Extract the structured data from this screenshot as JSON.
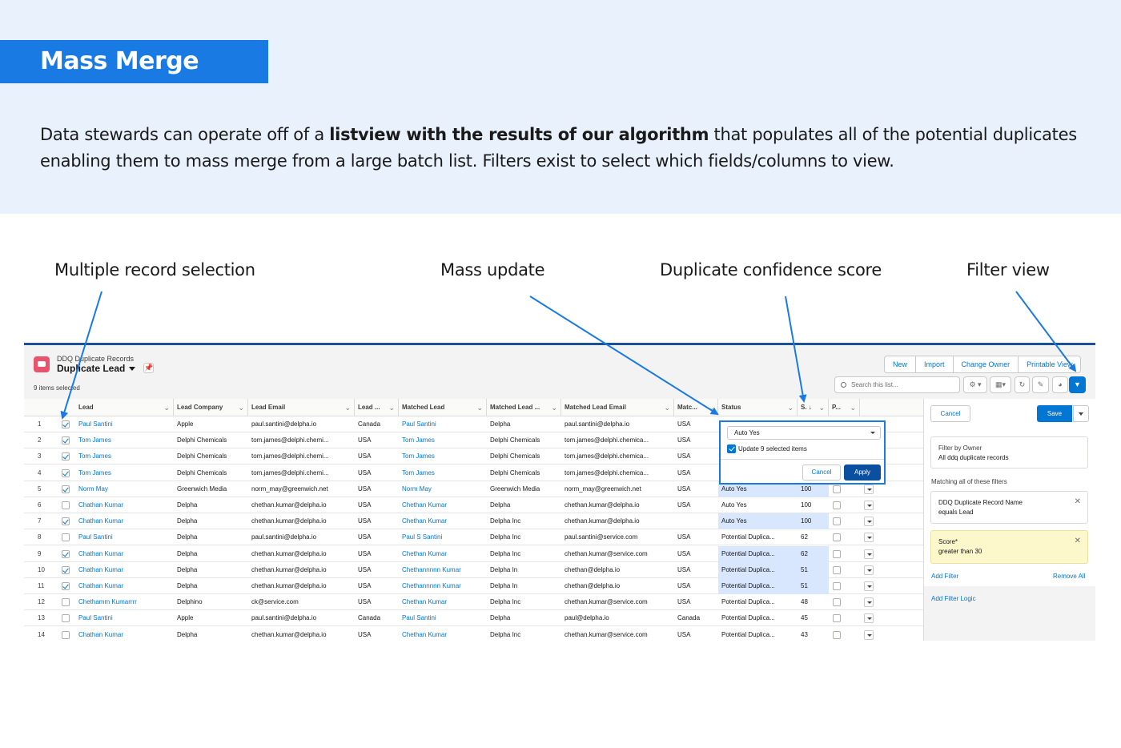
{
  "header": {
    "title": "Mass Merge",
    "desc_before": "Data stewards can operate off of a ",
    "desc_bold": "listview with the results of our algorithm",
    "desc_after": " that populates all of the potential duplicates enabling them to mass merge from a large batch list. Filters exist to select which fields/columns to view."
  },
  "callouts": {
    "selection": "Multiple record selection",
    "mass_update": "Mass update",
    "confidence": "Duplicate confidence score",
    "filter": "Filter view"
  },
  "colors": {
    "accent": "#1a7ae3",
    "link": "#0176d3",
    "highlight": "#d8e6fe",
    "warning": "#fcf8cc"
  },
  "app": {
    "object_subtitle": "DDQ Duplicate Records",
    "list_name": "Duplicate Lead",
    "selected_count": "9 items selected",
    "buttons": {
      "new": "New",
      "import": "Import",
      "change_owner": "Change Owner",
      "printable_view": "Printable View"
    },
    "search_placeholder": "Search this list...",
    "icons": [
      "settings-gear-icon",
      "table-view-icon",
      "refresh-icon",
      "edit-pencil-icon",
      "chart-icon",
      "filter-icon"
    ]
  },
  "columns": [
    "Lead",
    "Lead Company",
    "Lead Email",
    "Lead ...",
    "Matched Lead",
    "Matched Lead ...",
    "Matched Lead Email",
    "Matc...",
    "Status",
    "S. ↓",
    "P..."
  ],
  "rows": [
    {
      "n": "1",
      "sel": true,
      "lead": "Paul Santini",
      "company": "Apple",
      "email": "paul.santini@delpha.io",
      "country": "Canada",
      "m_lead": "Paul Santini",
      "m_company": "Delpha",
      "m_email": "paul.santini@delpha.io",
      "m_country": "USA",
      "status": "",
      "score": "",
      "hl": false
    },
    {
      "n": "2",
      "sel": true,
      "lead": "Tom James",
      "company": "Delphi Chemicals",
      "email": "tom.james@delphi.chemi...",
      "country": "USA",
      "m_lead": "Tom James",
      "m_company": "Delphi Chemicals",
      "m_email": "tom.james@delphi.chemica...",
      "m_country": "USA",
      "status": "",
      "score": "",
      "hl": false
    },
    {
      "n": "3",
      "sel": true,
      "lead": "Tom James",
      "company": "Delphi Chemicals",
      "email": "tom.james@delphi.chemi...",
      "country": "USA",
      "m_lead": "Tom James",
      "m_company": "Delphi Chemicals",
      "m_email": "tom.james@delphi.chemica...",
      "m_country": "USA",
      "status": "",
      "score": "",
      "hl": false
    },
    {
      "n": "4",
      "sel": true,
      "lead": "Tom James",
      "company": "Delphi Chemicals",
      "email": "tom.james@delphi.chemi...",
      "country": "USA",
      "m_lead": "Tom James",
      "m_company": "Delphi Chemicals",
      "m_email": "tom.james@delphi.chemica...",
      "m_country": "USA",
      "status": "",
      "score": "",
      "hl": false
    },
    {
      "n": "5",
      "sel": true,
      "lead": "Norm May",
      "company": "Greenwich Media",
      "email": "norm_may@greenwich.net",
      "country": "USA",
      "m_lead": "Norm May",
      "m_company": "Greenwich Media",
      "m_email": "norm_may@greenwich.net",
      "m_country": "USA",
      "status": "Auto Yes",
      "score": "100",
      "hl": true
    },
    {
      "n": "6",
      "sel": false,
      "lead": "Chathan Kumar",
      "company": "Delpha",
      "email": "chethan.kumar@delpha.io",
      "country": "USA",
      "m_lead": "Chethan Kumar",
      "m_company": "Delpha",
      "m_email": "chethan.kumar@delpha.io",
      "m_country": "USA",
      "status": "Auto Yes",
      "score": "100",
      "hl": false
    },
    {
      "n": "7",
      "sel": true,
      "lead": "Chathan Kumar",
      "company": "Delpha",
      "email": "chethan.kumar@delpha.io",
      "country": "USA",
      "m_lead": "Chethan Kumar",
      "m_company": "Delpha Inc",
      "m_email": "chethan.kumar@delpha.io",
      "m_country": "",
      "status": "Auto Yes",
      "score": "100",
      "hl": true
    },
    {
      "n": "8",
      "sel": false,
      "lead": "Paul Santini",
      "company": "Delpha",
      "email": "paul.santini@delpha.io",
      "country": "USA",
      "m_lead": "Paul S Santini",
      "m_company": "Delpha Inc",
      "m_email": "paul.santini@service.com",
      "m_country": "USA",
      "status": "Potential Duplica...",
      "score": "62",
      "hl": false
    },
    {
      "n": "9",
      "sel": true,
      "lead": "Chathan Kumar",
      "company": "Delpha",
      "email": "chethan.kumar@delpha.io",
      "country": "USA",
      "m_lead": "Chethan Kumar",
      "m_company": "Delpha Inc",
      "m_email": "chethan.kumar@service.com",
      "m_country": "USA",
      "status": "Potential Duplica...",
      "score": "62",
      "hl": true
    },
    {
      "n": "10",
      "sel": true,
      "lead": "Chathan Kumar",
      "company": "Delpha",
      "email": "chethan.kumar@delpha.io",
      "country": "USA",
      "m_lead": "Chethannnnn Kumar",
      "m_company": "Delpha In",
      "m_email": "chethan@delpha.io",
      "m_country": "USA",
      "status": "Potential Duplica...",
      "score": "51",
      "hl": true
    },
    {
      "n": "11",
      "sel": true,
      "lead": "Chathan Kumar",
      "company": "Delpha",
      "email": "chethan.kumar@delpha.io",
      "country": "USA",
      "m_lead": "Chethannnnn Kumar",
      "m_company": "Delpha In",
      "m_email": "chethan@delpha.io",
      "m_country": "USA",
      "status": "Potential Duplica...",
      "score": "51",
      "hl": true
    },
    {
      "n": "12",
      "sel": false,
      "lead": "Chethamm Kumarrrr",
      "company": "Delphino",
      "email": "ck@service.com",
      "country": "USA",
      "m_lead": "Chethan Kumar",
      "m_company": "Delpha Inc",
      "m_email": "chethan.kumar@service.com",
      "m_country": "USA",
      "status": "Potential Duplica...",
      "score": "48",
      "hl": false
    },
    {
      "n": "13",
      "sel": false,
      "lead": "Paul Santini",
      "company": "Apple",
      "email": "paul.santini@delpha.io",
      "country": "Canada",
      "m_lead": "Paul Santini",
      "m_company": "Delpha",
      "m_email": "paul@delpha.io",
      "m_country": "Canada",
      "status": "Potential Duplica...",
      "score": "45",
      "hl": false
    },
    {
      "n": "14",
      "sel": false,
      "lead": "Chathan Kumar",
      "company": "Delpha",
      "email": "chethan.kumar@delpha.io",
      "country": "USA",
      "m_lead": "Chethan Kumar",
      "m_company": "Delpha Inc",
      "m_email": "chethan.kumar@service.com",
      "m_country": "USA",
      "status": "Potential Duplica...",
      "score": "43",
      "hl": false
    }
  ],
  "popover": {
    "selected_value": "Auto Yes",
    "update_label": "Update 9 selected items",
    "cancel": "Cancel",
    "apply": "Apply"
  },
  "filter_panel": {
    "cancel": "Cancel",
    "save": "Save",
    "owner_label": "Filter by Owner",
    "owner_value": "All ddq duplicate records",
    "matching_label": "Matching all of these filters",
    "filter1_field": "DDQ Duplicate Record Name",
    "filter1_value": "equals  Lead",
    "filter2_field": "Score*",
    "filter2_value": "greater than  30",
    "add_filter": "Add Filter",
    "remove_all": "Remove All",
    "add_filter_logic": "Add Filter Logic"
  }
}
